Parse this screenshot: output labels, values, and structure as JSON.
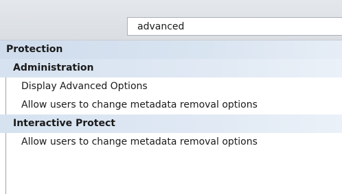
{
  "search": {
    "value": "advanced"
  },
  "tree": {
    "category": "Protection",
    "groups": [
      {
        "label": "Administration",
        "items": [
          "Display Advanced Options",
          "Allow users to change metadata removal options"
        ]
      },
      {
        "label": "Interactive Protect",
        "items": [
          "Allow users to change metadata removal options"
        ]
      }
    ]
  }
}
